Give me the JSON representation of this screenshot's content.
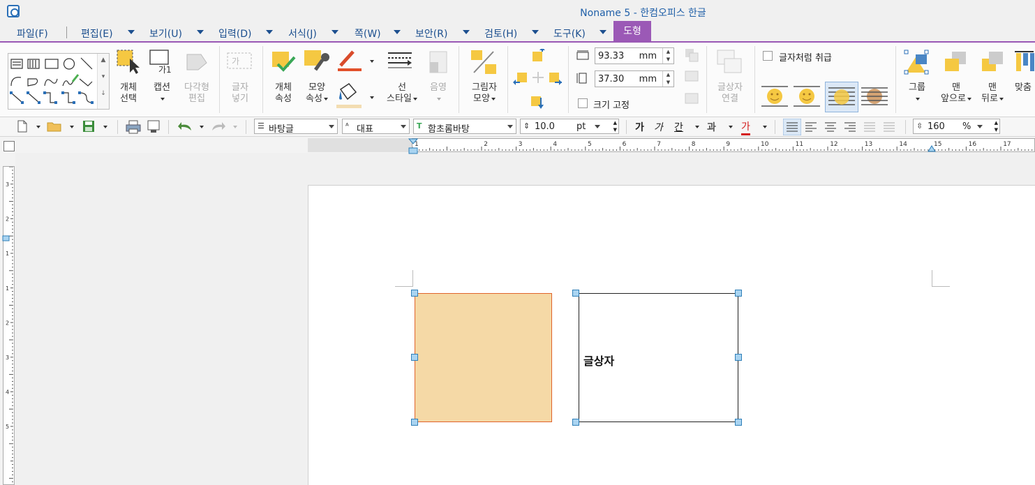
{
  "window": {
    "title": "Noname 5 - 한컴오피스 한글"
  },
  "menu": {
    "items": [
      "파일(F)",
      "편집(E)",
      "보기(U)",
      "입력(D)",
      "서식(J)",
      "쪽(W)",
      "보안(R)",
      "검토(H)",
      "도구(K)"
    ],
    "active_tab": "도형"
  },
  "ribbon": {
    "object_select": [
      "개체",
      "선택"
    ],
    "caption": "캡션",
    "polygon_edit": [
      "다각형",
      "편집"
    ],
    "insert_char": [
      "글자",
      "넣기"
    ],
    "object_props": [
      "개체",
      "속성"
    ],
    "shape_props": [
      "모양",
      "속성"
    ],
    "line_style": [
      "선",
      "스타일"
    ],
    "shading": "음영",
    "shadow_shape": [
      "그림자",
      "모양"
    ],
    "width_value": "93.33",
    "height_value": "37.30",
    "unit": "mm",
    "size_lock": "크기 고정",
    "textbox_link": [
      "글상자",
      "연결"
    ],
    "treat_as_char": "글자처럼 취급",
    "group": "그룹",
    "bring_front": [
      "맨",
      "앞으로"
    ],
    "send_back": [
      "맨",
      "뒤로"
    ],
    "align": "맞춤"
  },
  "toolbar": {
    "style": "바탕글",
    "language": "대표",
    "font": "함초롬바탕",
    "font_size": "10.0",
    "size_unit": "pt",
    "bold_glyph": "가",
    "italic_glyph": "가",
    "underline_glyph": "간",
    "outline_glyph": "과",
    "color_glyph": "가",
    "line_spacing": "160",
    "line_spacing_unit": "%"
  },
  "ruler_h_labels": [
    "2",
    "1",
    "1",
    "2",
    "3",
    "4",
    "5",
    "6",
    "7",
    "8",
    "9",
    "10",
    "11",
    "12",
    "13",
    "14",
    "15",
    "16",
    "17"
  ],
  "ruler_v_labels": [
    "3",
    "2",
    "1",
    "1",
    "2",
    "3",
    "4",
    "5"
  ],
  "document": {
    "textbox_text": "글상자",
    "rect_fill": "#f5d9a6",
    "rect_border": "#e0632b"
  },
  "colors": {
    "accent": "#9b59b6",
    "title_text": "#1f5fa8"
  }
}
